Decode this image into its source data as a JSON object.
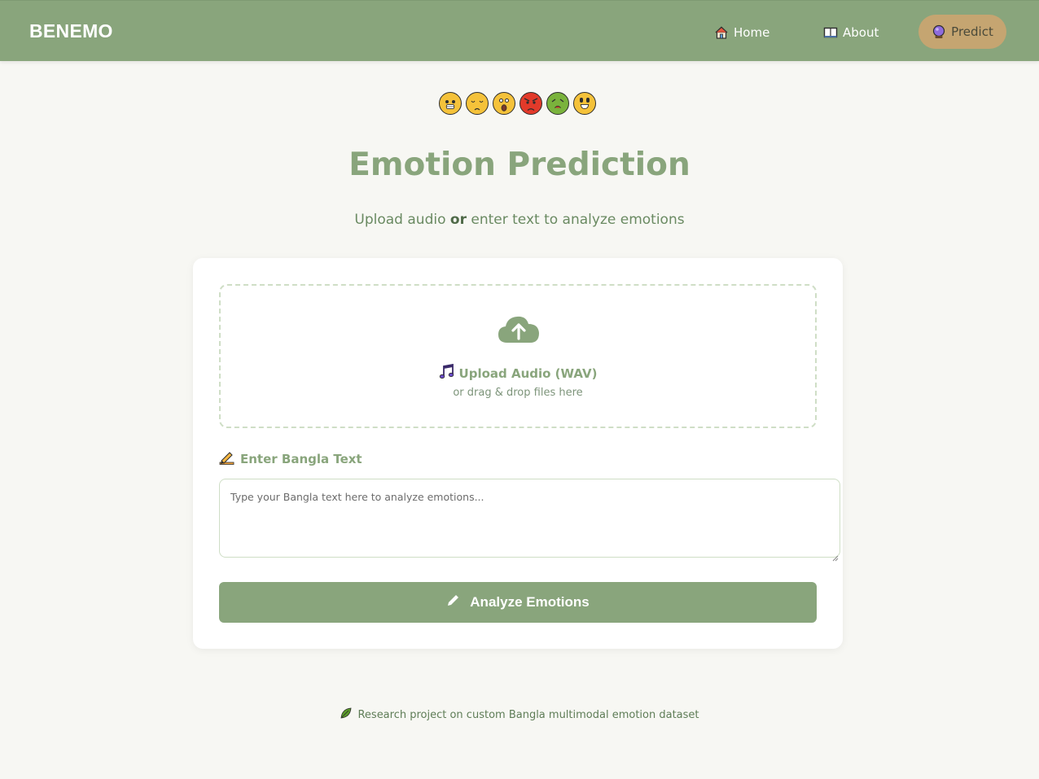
{
  "nav": {
    "brand": "BENEMO",
    "links": [
      {
        "label": "Home",
        "icon": "house-icon"
      },
      {
        "label": "About",
        "icon": "book-icon"
      },
      {
        "label": "Predict",
        "icon": "crystal-ball-icon"
      }
    ]
  },
  "emojis": [
    {
      "name": "grinning-face-icon",
      "color": "#f5c23a"
    },
    {
      "name": "sad-face-icon",
      "color": "#f5c23a"
    },
    {
      "name": "surprised-face-icon",
      "color": "#f5c23a"
    },
    {
      "name": "angry-face-icon",
      "color": "#e23a2a"
    },
    {
      "name": "nauseated-face-icon",
      "color": "#7ab33c"
    },
    {
      "name": "happy-face-icon",
      "color": "#f5c23a"
    }
  ],
  "main": {
    "title": "Emotion Prediction",
    "subtitle_before": "Upload audio ",
    "subtitle_bold": "or",
    "subtitle_after": " enter text to analyze emotions"
  },
  "upload": {
    "icon": "cloud-upload-icon",
    "label": "Upload Audio (WAV)",
    "hint": "or drag & drop files here"
  },
  "text_input": {
    "label": "Enter Bangla Text",
    "placeholder": "Type your Bangla text here to analyze emotions...",
    "value": ""
  },
  "action": {
    "button_label": "Analyze Emotions"
  },
  "footer": {
    "text": "Research project on custom Bangla multimodal emotion dataset"
  },
  "colors": {
    "accent": "#89a57c",
    "predict_pill": "#c5a571",
    "background": "#f7f7f3"
  }
}
